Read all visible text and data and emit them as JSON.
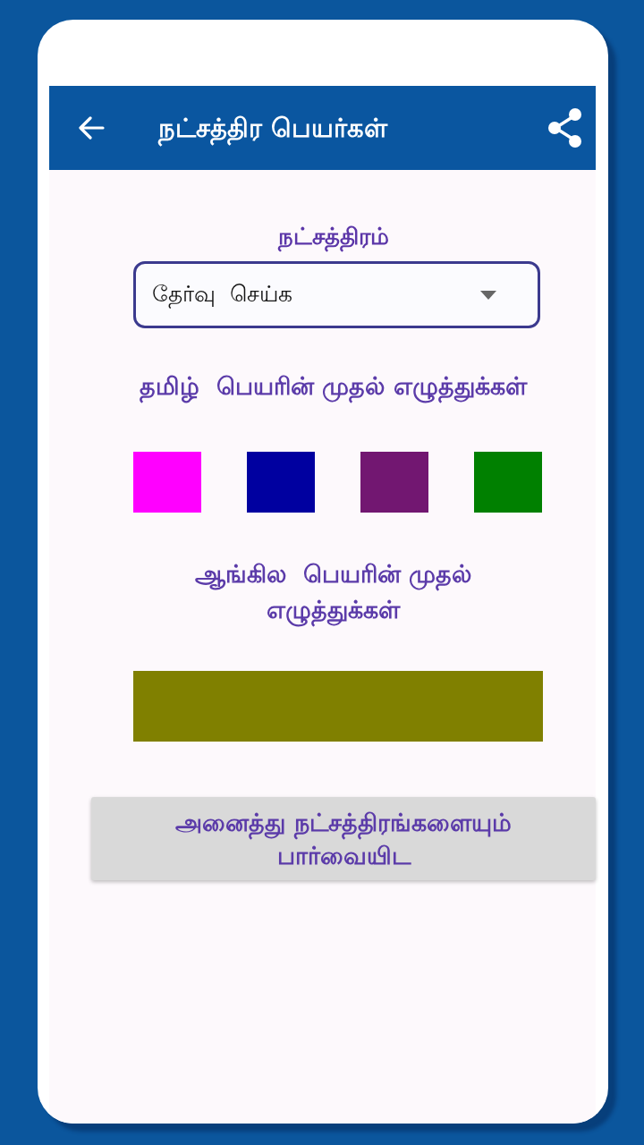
{
  "toolbar": {
    "title": "நட்சத்திர பெயர்கள்"
  },
  "star_select": {
    "label": "நட்சத்திரம்",
    "value": "தேர்வு  செய்க"
  },
  "tamil_letters": {
    "heading": "தமிழ்  பெயரின் முதல் எழுத்துக்கள்",
    "boxes": [
      {
        "color": "#ff00ff"
      },
      {
        "color": "#0000a0"
      },
      {
        "color": "#721771"
      },
      {
        "color": "#008000"
      }
    ]
  },
  "english_letters": {
    "heading": "ஆங்கில  பெயரின் முதல் எழுத்துக்கள்"
  },
  "view_all_button": {
    "label": "அனைத்து நட்சத்திரங்களையும் பார்வையிட"
  }
}
